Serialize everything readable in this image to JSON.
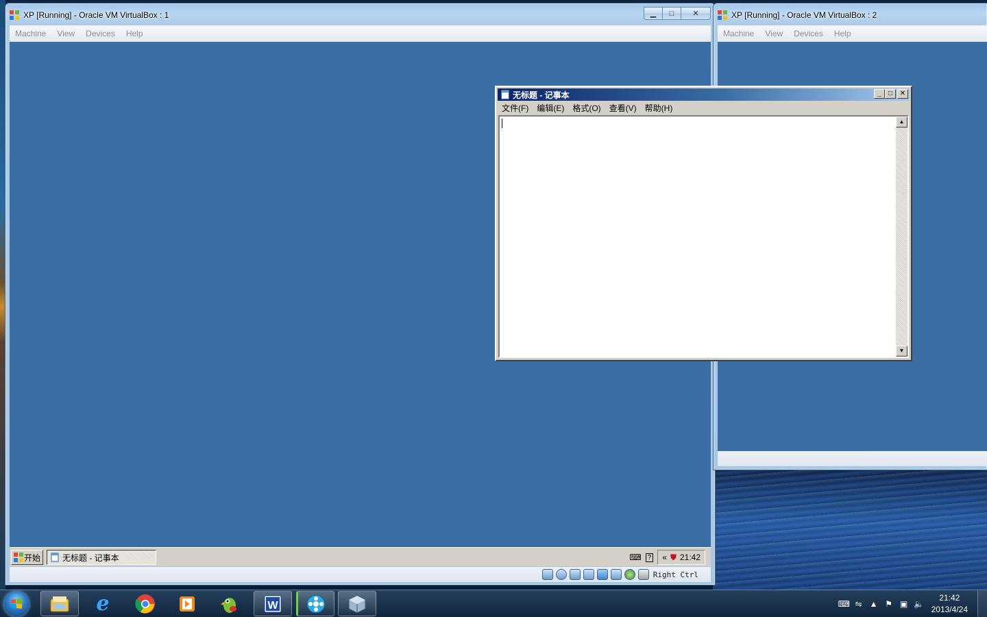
{
  "vm1": {
    "title": "XP [Running] - Oracle VM VirtualBox : 1",
    "menu": [
      "Machine",
      "View",
      "Devices",
      "Help"
    ],
    "xp_start_label": "开始",
    "xp_task_label": "无标题 - 记事本",
    "xp_clock": "21:42",
    "xp_tray_arrows": "«",
    "host_key": "Right Ctrl"
  },
  "vm2": {
    "title": "XP [Running] - Oracle VM VirtualBox : 2",
    "menu": [
      "Machine",
      "View",
      "Devices",
      "Help"
    ]
  },
  "notepad": {
    "title": "无标题 - 记事本",
    "menu": [
      "文件(F)",
      "编辑(E)",
      "格式(O)",
      "查看(V)",
      "帮助(H)"
    ],
    "content": ""
  },
  "taskbar": {
    "pinned": [
      "windows-explorer-icon",
      "internet-explorer-icon",
      "chrome-icon",
      "media-player-icon",
      "parrot-app-icon",
      "wps-writer-icon",
      "video-app-icon",
      "virtualbox-icon"
    ],
    "clock_time": "21:42",
    "clock_date": "2013/4/24"
  },
  "colors": {
    "xp_desktop": "#3a6ea5",
    "xp_title_active": "#0a246a",
    "classic_face": "#d4d0c8"
  }
}
